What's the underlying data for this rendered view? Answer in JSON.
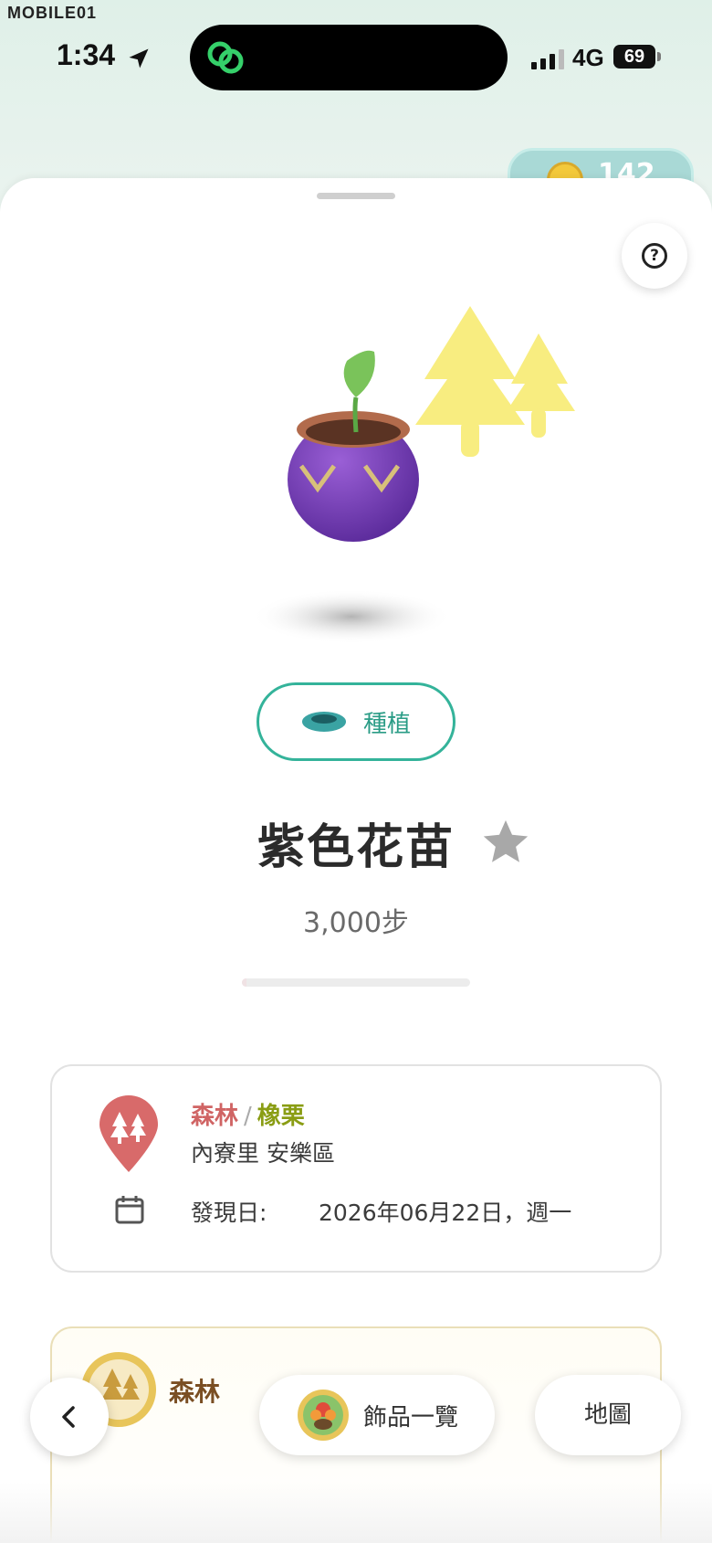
{
  "watermark": {
    "text": "MOBILE01"
  },
  "status_bar": {
    "time": "1:34",
    "network": "4G",
    "battery": "69"
  },
  "header": {
    "coin_count": "142"
  },
  "item": {
    "action_label": "種植",
    "name": "紫色花苗",
    "steps": "3,000步",
    "progress": 0.0
  },
  "location_card": {
    "category": "森林",
    "separator": "/",
    "subcategory": "橡栗",
    "area": "內寮里 安樂區",
    "found_label": "發現日:",
    "found_date": "2026年06月22日，週一"
  },
  "forest_card": {
    "title": "森林"
  },
  "bottom_nav": {
    "decorations_label": "飾品一覽",
    "map_label": "地圖"
  },
  "icons": {
    "location": "location-arrow-icon",
    "help": "help-icon",
    "star": "star-icon",
    "pin": "forest-pin-icon",
    "calendar": "calendar-icon",
    "back": "chevron-left-icon"
  },
  "colors": {
    "accent": "#34b39a",
    "forest_red": "#d06464",
    "acorn_green": "#8a9d14",
    "star_gray": "#a8a8a8"
  }
}
